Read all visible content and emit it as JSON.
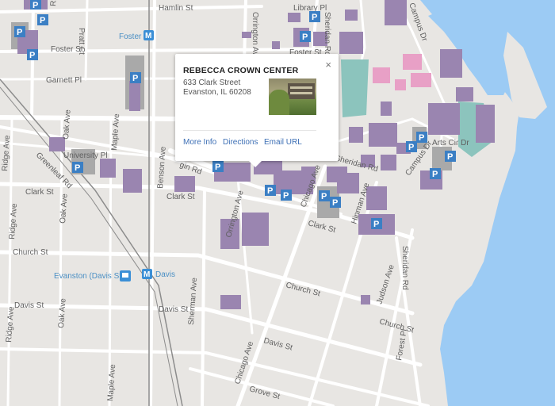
{
  "colors": {
    "land": "#e8e6e3",
    "road": "#ffffff",
    "water": "#9ccbf4",
    "building": "#9a85b0",
    "grey_building": "#a9a9a9",
    "pink_building": "#e8a0c6",
    "teal_area": "#8cc4bd",
    "parking": "#3b7fc4",
    "metro": "#3b8fd6"
  },
  "streets": {
    "hamlin": "Hamlin St",
    "library": "Library Pl",
    "foster_w": "Foster St",
    "foster_e": "Foster St",
    "garnett": "Garnett Pl",
    "university": "University Pl",
    "clark_w": "Clark St",
    "clark_m": "Clark St",
    "clark_e": "Clark St",
    "church_w": "Church St",
    "church_m": "Church St",
    "church_e": "Church St",
    "davis_w": "Davis St",
    "davis_m": "Davis St",
    "davis_e": "Davis St",
    "grove": "Grove St",
    "sheridan_n": "Sheridan Rd",
    "sheridan_m": "Sheridan Rd",
    "sheridan_s": "Sheridan Rd",
    "campus_dr_n": "Campus Dr",
    "campus_dr_s": "Campus Dr",
    "arts_cir": "Arts Cir Dr",
    "pratt": "Pratt Ct",
    "orrington_n": "Orrington Ave",
    "orrington_s": "Orrington Ave",
    "chicago_n": "Chicago Ave",
    "chicago_s": "Chicago Ave",
    "hinman": "Hinman Ave",
    "judson": "Judson Ave",
    "forest": "Forest Pl",
    "sherman": "Sherman Ave",
    "benson": "Benson Ave",
    "maple_n": "Maple Ave",
    "maple_s": "Maple Ave",
    "oak_n": "Oak Ave",
    "oak_m": "Oak Ave",
    "oak_s": "Oak Ave",
    "ridge_n": "Ridge Ave",
    "ridge_m": "Ridge Ave",
    "ridge_s": "Ridge Ave",
    "greenleaf": "Greenleaf Rd",
    "ridge_top": "Ridge",
    "emerson": "gin Rd"
  },
  "pois": {
    "foster_station": "Foster",
    "davis_station": "Davis",
    "evanston_station": "Evanston (Davis St)",
    "metro_glyph": "M",
    "parking_glyph": "P"
  },
  "popup": {
    "title": "REBECCA CROWN CENTER",
    "address_line1": "633 Clark Street",
    "address_line2": "Evanston, IL 60208",
    "more_info": "More Info",
    "directions": "Directions",
    "email_url": "Email URL",
    "close": "×"
  }
}
